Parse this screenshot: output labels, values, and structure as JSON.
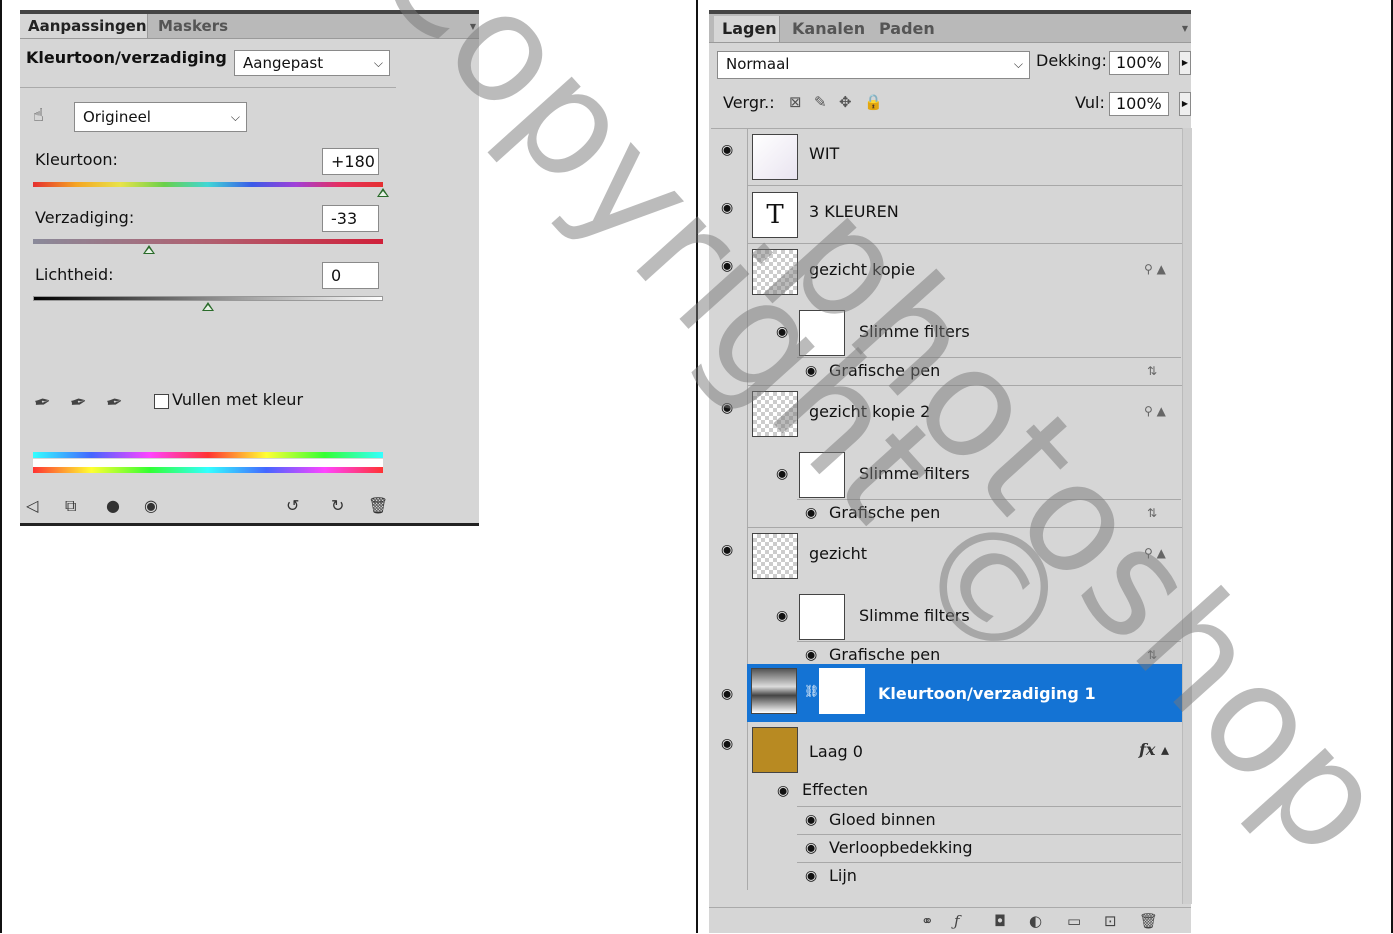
{
  "adjustments": {
    "tabs": [
      "Aanpassingen",
      "Maskers"
    ],
    "title": "Kleurtoon/verzadiging",
    "preset": "Aangepast",
    "channel": "Origineel",
    "hue": {
      "label": "Kleurtoon:",
      "value": "+180"
    },
    "saturation": {
      "label": "Verzadiging:",
      "value": "-33"
    },
    "lightness": {
      "label": "Lichtheid:",
      "value": "0"
    },
    "colorize_label": "Vullen met kleur",
    "colorize_checked": false,
    "hue_level": 1.0,
    "saturation_level": 0.33,
    "lightness_level": 0.5
  },
  "layers": {
    "tabs": [
      "Lagen",
      "Kanalen",
      "Paden"
    ],
    "blend_mode": "Normaal",
    "opacity_label": "Dekking:",
    "opacity": "100%",
    "lock_label": "Vergr.:",
    "fill_label": "Vul:",
    "fill": "100%",
    "items": {
      "wit": "WIT",
      "kleuren": "3 KLEUREN",
      "gezicht_kopie": "gezicht kopie",
      "gezicht_kopie_2": "gezicht kopie 2",
      "gezicht": "gezicht",
      "smart_filters": "Slimme filters",
      "graphic_pen": "Grafische pen",
      "adjustment": "Kleurtoon/verzadiging 1",
      "laag0": "Laag 0",
      "effects": "Effecten",
      "inner_glow": "Gloed binnen",
      "gradient_overlay": "Verloopbedekking",
      "stroke": "Lijn",
      "text_glyph": "T",
      "fx_glyph": "fx"
    },
    "selected": "Kleurtoon/verzadiging 1"
  },
  "watermark": {
    "line1": "Copyright ©",
    "line2": "photoshop"
  },
  "colors": {
    "selection": "#1473d4",
    "panel": "#d6d6d6",
    "swatch_laag0": "#b88a22"
  }
}
